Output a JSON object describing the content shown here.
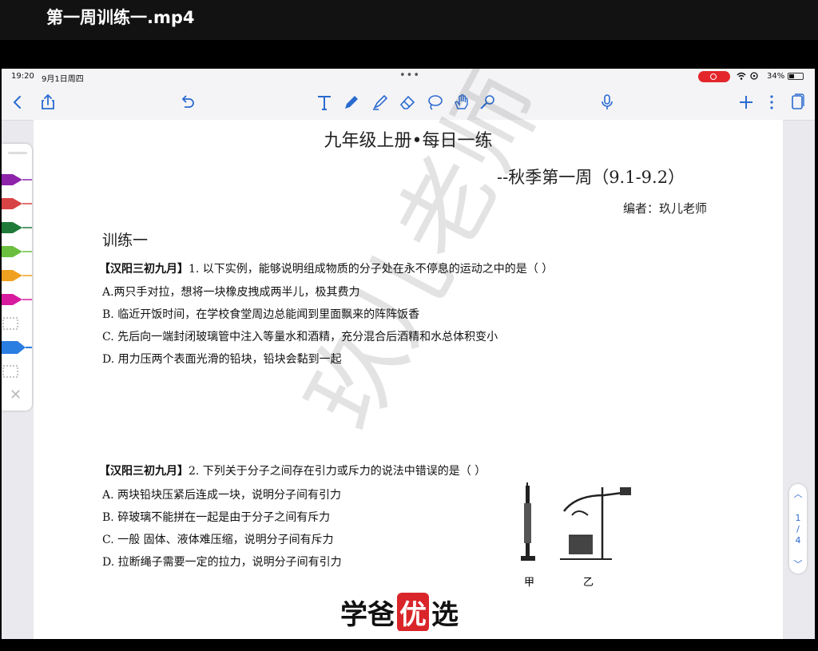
{
  "video": {
    "title": "第一周训练一.mp4"
  },
  "status": {
    "time": "19:20",
    "date": "9月1日周四",
    "dots": "•••",
    "battery": "34%"
  },
  "document": {
    "title": "九年级上册•每日一练",
    "subtitle": "--秋季第一周（9.1-9.2）",
    "editor": "编者：玖儿老师",
    "section": "训练一",
    "questions": [
      {
        "source": "【汉阳三初九月】",
        "text": "1. 以下实例，能够说明组成物质的分子处在永不停息的运动之中的是（      ）",
        "options": [
          "A.两只手对拉，想将一块橡皮拽成两半儿，极其费力",
          "B. 临近开饭时间，在学校食堂周边总能闻到里面飘来的阵阵饭香",
          "C. 先后向一端封闭玻璃管中注入等量水和酒精，充分混合后酒精和水总体积变小",
          "D. 用力压两个表面光滑的铅块，铅块会黏到一起"
        ]
      },
      {
        "source": "【汉阳三初九月】",
        "text": "2. 下列关于分子之间存在引力或斥力的说法中错误的是（      ）",
        "options": [
          "A. 两块铅块压紧后连成一块，说明分子间有引力",
          "B. 碎玻璃不能拼在一起是由于分子之间有斥力",
          "C. 一般  固体、液体难压缩，说明分子间有斥力",
          "D. 拉断绳子需要一定的拉力，说明分子间有引力"
        ]
      }
    ],
    "figure_labels": [
      "甲",
      "乙"
    ],
    "watermark": "玖儿老师"
  },
  "brand": {
    "part1": "学爸",
    "part2": "优",
    "part3": "选"
  },
  "pager": {
    "current": "1",
    "separator": "/",
    "total": "4"
  },
  "pens": [
    "#8e24aa",
    "#d84343",
    "#1f7a3a",
    "#6abf3f",
    "#f0a020",
    "#d81b9e"
  ],
  "accent": "#2a6ad0"
}
